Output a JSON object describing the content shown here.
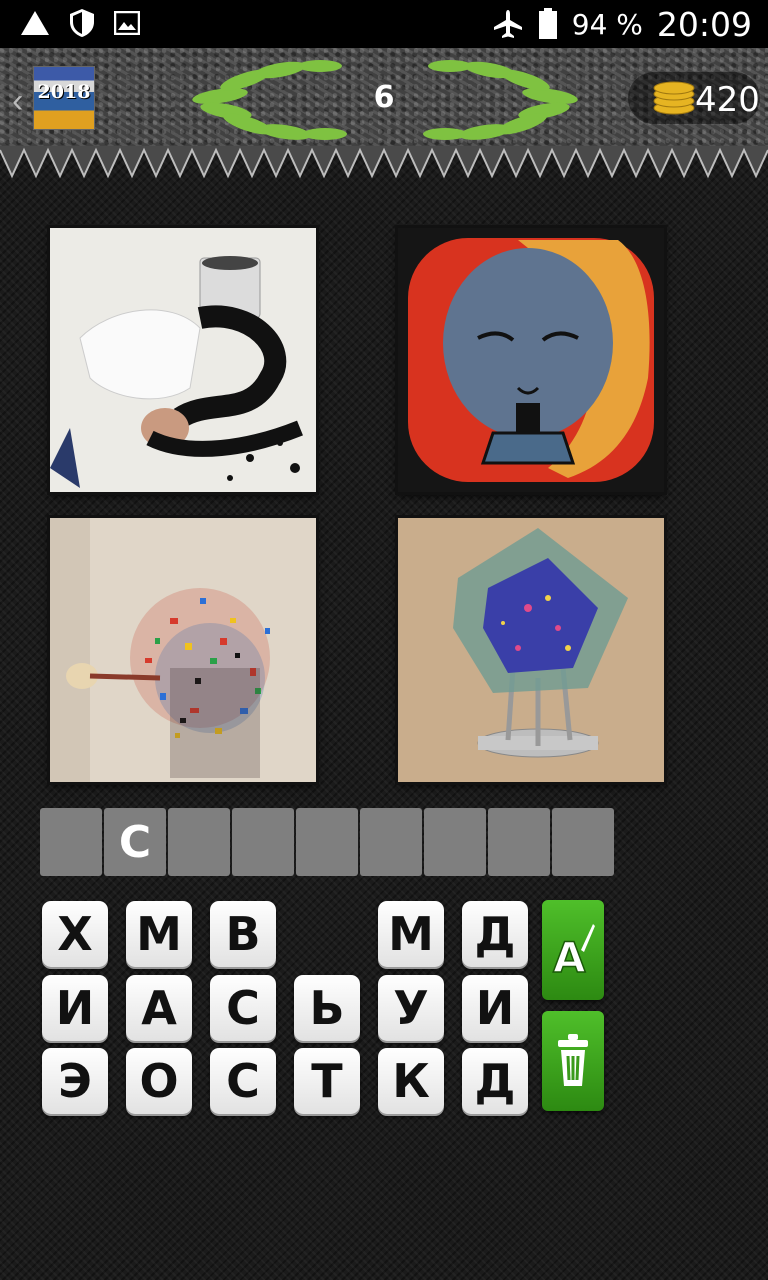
{
  "status_bar": {
    "battery": "94 %",
    "time": "20:09",
    "icons": [
      "warning-triangle-icon",
      "shield-icon",
      "image-icon",
      "airplane-icon",
      "battery-icon"
    ]
  },
  "header": {
    "logo_text": "2018",
    "level": "6",
    "coins": "420",
    "colors": {
      "wreath": "#7fc241",
      "coins": "#e6b422"
    }
  },
  "pictures": [
    {
      "subject": "performance-painting-photo"
    },
    {
      "subject": "painted-plate-photo"
    },
    {
      "subject": "exploding-color-sculpture-photo"
    },
    {
      "subject": "glass-cube-sculpture-photo"
    }
  ],
  "answer": {
    "slots": [
      "",
      "С",
      "",
      "",
      "",
      "",
      "",
      "",
      ""
    ]
  },
  "letters": {
    "row1": [
      "Х",
      "М",
      "В",
      "",
      "М",
      "Д"
    ],
    "row2": [
      "И",
      "А",
      "С",
      "Ь",
      "У",
      "И"
    ],
    "row3": [
      "Э",
      "О",
      "С",
      "Т",
      "К",
      "Д"
    ]
  },
  "buttons": {
    "hint_icon": "letter-hint-icon",
    "delete_icon": "trash-icon",
    "color": "#3aa51c"
  }
}
